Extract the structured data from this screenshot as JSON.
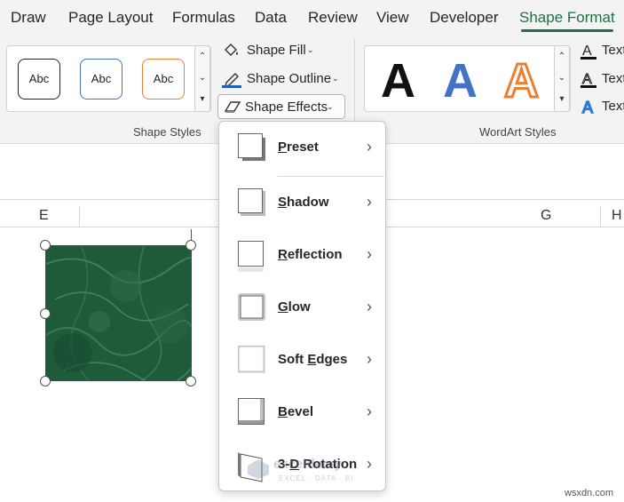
{
  "tabs": [
    {
      "label": "Draw"
    },
    {
      "label": "Page Layout"
    },
    {
      "label": "Formulas"
    },
    {
      "label": "Data"
    },
    {
      "label": "Review"
    },
    {
      "label": "View"
    },
    {
      "label": "Developer"
    },
    {
      "label": "Shape Format",
      "active": true
    }
  ],
  "ribbon": {
    "shape_styles": {
      "thumbs": [
        "Abc",
        "Abc",
        "Abc"
      ],
      "group_label": "Shape Styles"
    },
    "commands": {
      "shape_fill": "Shape Fill",
      "shape_outline": "Shape Outline",
      "shape_effects": "Shape Effects"
    },
    "wordart": {
      "letters": [
        "A",
        "A",
        "A"
      ],
      "group_label": "WordArt Styles",
      "text_cmds": [
        "Text",
        "Text",
        "Text"
      ]
    }
  },
  "sheet": {
    "columns": [
      "E",
      "G",
      "H"
    ]
  },
  "menu": {
    "items": [
      {
        "pre": "",
        "ul": "P",
        "post": "reset"
      },
      {
        "pre": "",
        "ul": "S",
        "post": "hadow"
      },
      {
        "pre": "",
        "ul": "R",
        "post": "eflection"
      },
      {
        "pre": "",
        "ul": "G",
        "post": "low"
      },
      {
        "pre": "Soft ",
        "ul": "E",
        "post": "dges"
      },
      {
        "pre": "",
        "ul": "B",
        "post": "evel"
      },
      {
        "pre": "3-",
        "ul": "D",
        "post": " Rotation"
      }
    ]
  },
  "watermarks": {
    "brand_name": "exceldemy",
    "brand_tagline": "EXCEL · DATA · BI",
    "site": "wsxdn.com"
  },
  "colors": {
    "accent": "#1e7145",
    "outline_blue": "#4472c4",
    "outline_orange": "#ed7d31",
    "shape_green": "#1f5a3a"
  }
}
